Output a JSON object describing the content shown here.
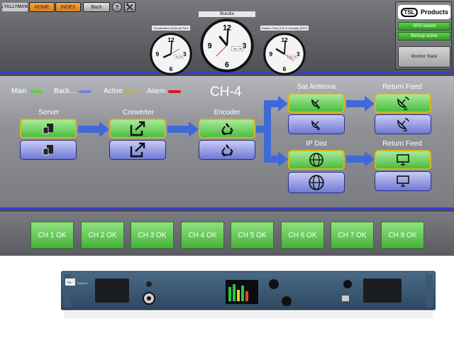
{
  "header": {
    "logo_text": "TALLYMAN",
    "buttons": {
      "home": "HOME",
      "index": "INDEX",
      "back": "Back",
      "help": "?"
    },
    "clocks": [
      {
        "label": "Coordinated Universal Time",
        "date": "Thu 7th"
      },
      {
        "label": "Brasilia",
        "date": "Thu 7th"
      },
      {
        "label": "Eastern Time (U.S & Canada) (DST)",
        "date": "Thu 7th"
      }
    ],
    "brand": {
      "badge": "TSL",
      "text": "Products"
    },
    "status": {
      "spg": "SPG locked",
      "backup": "Backup active"
    },
    "monitor_stack": "Monitor Stack"
  },
  "chain": {
    "channel_title": "CH-4",
    "legend": [
      {
        "label": "Main",
        "color": "#5fcf4a"
      },
      {
        "label": "Back...",
        "color": "#7a84d8"
      },
      {
        "label": "Active",
        "color": "#d4b720"
      },
      {
        "label": "Alarm",
        "color": "#e01818"
      }
    ],
    "nodes": {
      "server": "Server",
      "converter": "Converter",
      "encoder": "Encoder",
      "sat_antenna": "Sat Antenna",
      "ip_dist": "IP Dist",
      "return_feed_sat": "Return Feed",
      "return_feed_ip": "Return Feed"
    },
    "arrow_color": "#3f6ad6"
  },
  "channels": [
    "CH 1 OK",
    "CH 2 OK",
    "CH 3 OK",
    "CH 4 OK",
    "CH 5 OK",
    "CH 6 OK",
    "CH 7 OK",
    "CH 8 OK"
  ],
  "hardware": {
    "brand_text": "TSL",
    "model_text": "TallyMan"
  }
}
